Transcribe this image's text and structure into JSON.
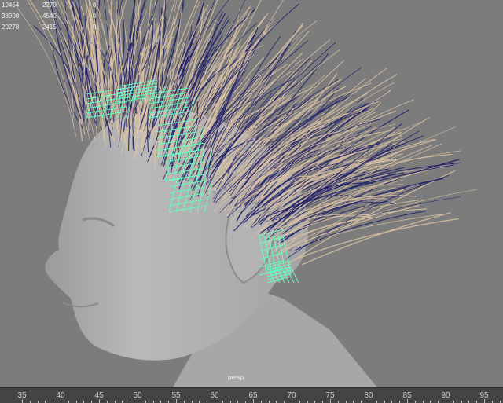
{
  "stats": {
    "rows": [
      [
        "19454",
        "2270",
        "0"
      ],
      [
        "38908",
        "4540",
        "0"
      ],
      [
        "20278",
        "2415",
        "0"
      ]
    ]
  },
  "viewport": {
    "camera_name": "persp"
  },
  "timeline": {
    "ticks": [
      "35",
      "40",
      "45",
      "50",
      "55",
      "60",
      "65",
      "70",
      "75",
      "80",
      "85",
      "90",
      "95"
    ]
  },
  "colors": {
    "viewport_bg": "#7c7c7c",
    "timeline_bg": "#444444",
    "guide_mesh": "#63ffbe",
    "hair_light": "#d9c2a3",
    "hair_dark": "#1f1f6b"
  }
}
